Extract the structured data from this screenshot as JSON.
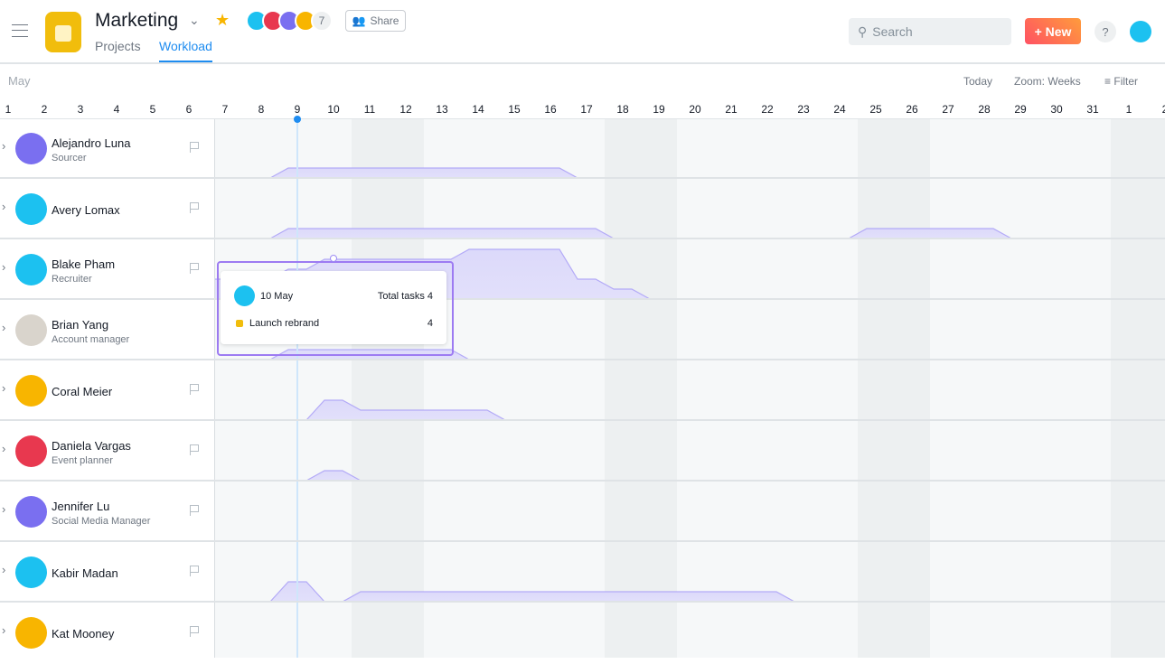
{
  "header": {
    "title": "Marketing",
    "tabs": [
      {
        "label": "Projects",
        "active": false
      },
      {
        "label": "Workload",
        "active": true
      }
    ],
    "member_count": "7",
    "share_label": "Share",
    "search_placeholder": "Search",
    "new_label": "New",
    "help_label": "?",
    "project_color": "#f1bd0c",
    "accent": "#1e8cf0"
  },
  "members": [
    {
      "color": "#1cc1f0"
    },
    {
      "color": "#e8384f"
    },
    {
      "color": "#7a6ff0"
    },
    {
      "color": "#f8b500"
    }
  ],
  "toolbar": {
    "month": "May",
    "today": "Today",
    "zoom": "Zoom: Weeks",
    "filter": "Filter"
  },
  "timeline": {
    "days": [
      "1",
      "2",
      "3",
      "4",
      "5",
      "6",
      "7",
      "8",
      "9",
      "10",
      "11",
      "12",
      "13",
      "14",
      "15",
      "16",
      "17",
      "18",
      "19",
      "20",
      "21",
      "22",
      "23",
      "24",
      "25",
      "26",
      "27",
      "28",
      "29",
      "30",
      "31",
      "1",
      "2"
    ],
    "today": "9",
    "weekends": [
      "11",
      "12",
      "18",
      "19",
      "25",
      "26",
      "1",
      "2"
    ]
  },
  "people": [
    {
      "name": "Alejandro Luna",
      "role": "Sourcer",
      "color": "#7a6ff0",
      "flag": true,
      "load": [
        [
          [
            8.25,
            0
          ],
          [
            8.75,
            1
          ],
          [
            16.25,
            1
          ],
          [
            16.75,
            0
          ]
        ]
      ]
    },
    {
      "name": "Avery Lomax",
      "role": "",
      "color": "#1cc1f0",
      "flag": true,
      "load": [
        [
          [
            8.25,
            0
          ],
          [
            8.75,
            1
          ],
          [
            17.25,
            1
          ],
          [
            17.75,
            0
          ]
        ],
        [
          [
            24.25,
            0
          ],
          [
            24.75,
            1
          ],
          [
            28.25,
            1
          ],
          [
            28.75,
            0
          ]
        ]
      ]
    },
    {
      "name": "Blake Pham",
      "role": "Recruiter",
      "color": "#1cc1f0",
      "flag": true,
      "load": [
        [
          [
            6.5,
            2
          ],
          [
            8.25,
            2
          ],
          [
            8.75,
            3
          ],
          [
            9.25,
            3
          ],
          [
            9.75,
            4
          ],
          [
            13.25,
            4
          ],
          [
            13.75,
            5
          ],
          [
            16.25,
            5
          ],
          [
            16.75,
            2
          ],
          [
            17.25,
            2
          ],
          [
            17.75,
            1
          ],
          [
            18.25,
            1
          ],
          [
            18.75,
            0
          ]
        ]
      ]
    },
    {
      "name": "Brian Yang",
      "role": "Account manager",
      "color": "#d9d4cc",
      "flag": false,
      "load": [
        [
          [
            8.25,
            0
          ],
          [
            8.75,
            1
          ],
          [
            13.25,
            1
          ],
          [
            13.75,
            0
          ]
        ]
      ]
    },
    {
      "name": "Coral Meier",
      "role": "",
      "color": "#f8b500",
      "flag": true,
      "load": [
        [
          [
            9.25,
            0
          ],
          [
            9.75,
            2
          ],
          [
            10.25,
            2
          ],
          [
            10.75,
            1
          ],
          [
            14.25,
            1
          ],
          [
            14.75,
            0
          ]
        ]
      ]
    },
    {
      "name": "Daniela Vargas",
      "role": "Event planner",
      "color": "#e8384f",
      "flag": true,
      "load": [
        [
          [
            9.25,
            0
          ],
          [
            9.75,
            1
          ],
          [
            10.25,
            1
          ],
          [
            10.75,
            0
          ]
        ]
      ]
    },
    {
      "name": "Jennifer Lu",
      "role": "Social Media Manager",
      "color": "#7a6ff0",
      "flag": true,
      "load": []
    },
    {
      "name": "Kabir Madan",
      "role": "",
      "color": "#1cc1f0",
      "flag": true,
      "load": [
        [
          [
            8.25,
            0
          ],
          [
            8.75,
            2
          ],
          [
            9.25,
            2
          ],
          [
            9.75,
            0
          ]
        ],
        [
          [
            10.25,
            0
          ],
          [
            10.75,
            1
          ],
          [
            22.25,
            1
          ],
          [
            22.75,
            0
          ]
        ]
      ]
    },
    {
      "name": "Kat Mooney",
      "role": "",
      "color": "#f8b500",
      "flag": true,
      "load": []
    }
  ],
  "tooltip": {
    "date": "10 May",
    "total": "Total tasks 4",
    "project": "Launch rebrand",
    "count": "4",
    "project_color": "#f1bd0c"
  }
}
